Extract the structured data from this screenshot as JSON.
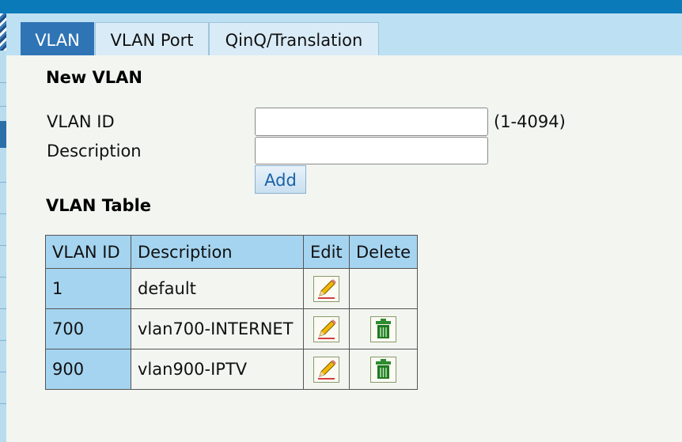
{
  "tabs": [
    {
      "label": "VLAN",
      "active": true
    },
    {
      "label": "VLAN Port",
      "active": false
    },
    {
      "label": "QinQ/Translation",
      "active": false
    }
  ],
  "new_vlan": {
    "title": "New VLAN",
    "vlan_id_label": "VLAN ID",
    "vlan_id_value": "",
    "vlan_id_hint": "(1-4094)",
    "description_label": "Description",
    "description_value": "",
    "add_label": "Add"
  },
  "vlan_table": {
    "title": "VLAN Table",
    "headers": [
      "VLAN ID",
      "Description",
      "Edit",
      "Delete"
    ],
    "rows": [
      {
        "id": "1",
        "description": "default",
        "deletable": false
      },
      {
        "id": "700",
        "description": "vlan700-INTERNET",
        "deletable": true
      },
      {
        "id": "900",
        "description": "vlan900-IPTV",
        "deletable": true
      }
    ]
  },
  "colors": {
    "top_bar": "#0a7ab8",
    "tab_active": "#2f74b5",
    "table_header": "#a5d4f0",
    "background": "#f3f5f0"
  },
  "icons": {
    "edit": "pencil-icon",
    "delete": "trash-icon"
  }
}
